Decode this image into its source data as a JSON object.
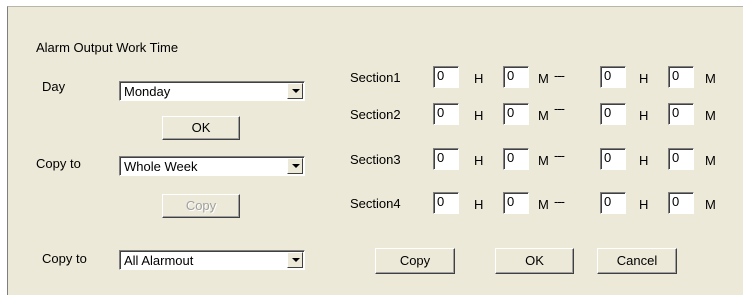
{
  "left": {
    "heading": "Alarm Output Work Time",
    "day_label": "Day",
    "day_value": "Monday",
    "ok_label": "OK",
    "copy_to_label": "Copy to",
    "copy_to_value": "Whole Week",
    "copy_label": "Copy",
    "copy_to2_label": "Copy to",
    "copy_to2_value": "All Alarmout"
  },
  "sections": [
    {
      "label": "Section1",
      "start_h": "0",
      "start_m": "0",
      "end_h": "0",
      "end_m": "0"
    },
    {
      "label": "Section2",
      "start_h": "0",
      "start_m": "0",
      "end_h": "0",
      "end_m": "0"
    },
    {
      "label": "Section3",
      "start_h": "0",
      "start_m": "0",
      "end_h": "0",
      "end_m": "0"
    },
    {
      "label": "Section4",
      "start_h": "0",
      "start_m": "0",
      "end_h": "0",
      "end_m": "0"
    }
  ],
  "units": {
    "hour": "H",
    "minute": "M",
    "separator": "---"
  },
  "bottom": {
    "copy_label": "Copy",
    "ok_label": "OK",
    "cancel_label": "Cancel"
  }
}
